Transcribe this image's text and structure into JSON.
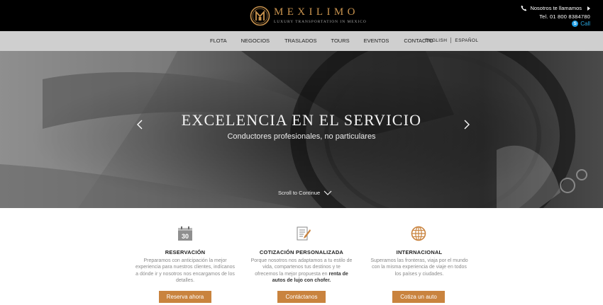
{
  "header": {
    "logo_name": "MEXILIMO",
    "logo_tagline": "LUXURY TRANSPORTATION IN MEXICO",
    "callback_label": "Nosotros te llamamos",
    "phone": "Tel. 01 800 8384780",
    "skype_label": "Call"
  },
  "nav": {
    "items": [
      {
        "label": "FLOTA"
      },
      {
        "label": "NEGOCIOS"
      },
      {
        "label": "TRASLADOS"
      },
      {
        "label": "TOURS"
      },
      {
        "label": "EVENTOS"
      },
      {
        "label": "CONTACTO"
      }
    ],
    "languages": [
      "ENGLISH",
      "ESPAÑOL"
    ]
  },
  "hero": {
    "title": "EXCELENCIA EN EL SERVICIO",
    "subtitle": "Conductores profesionales, no particulares",
    "scroll_label": "Scroll to Continue"
  },
  "features": [
    {
      "icon": "calendar-icon",
      "icon_text": "30",
      "title": "RESERVACIÓN",
      "text": "Preparamos con anticipación la mejor experiencia para nuestros clientes, indícanos a dónde ir y nosotros nos encargamos de los detalles.",
      "button": "Reserva ahora"
    },
    {
      "icon": "quote-document-icon",
      "title": "COTIZACIÓN PERSONALIZADA",
      "text": "Porque nosotros nos adaptamos a tu estilo de vida,  compartenos tus destinos y te ofrecemos la mejor propuesta en",
      "text_bold": "renta de autos de lujo con chofer.",
      "button": "Contáctanos"
    },
    {
      "icon": "globe-icon",
      "title": "INTERNACIONAL",
      "text": "Superamos las fronteras, viaja por el mundo con la misma experiencia de viaje en todos los países y ciudades.",
      "button": "Cotiza un auto"
    }
  ],
  "colors": {
    "accent": "#c9833e",
    "logo_gold": "#c9934e",
    "header_bg": "#000000",
    "nav_bg": "#cfcfcf"
  }
}
